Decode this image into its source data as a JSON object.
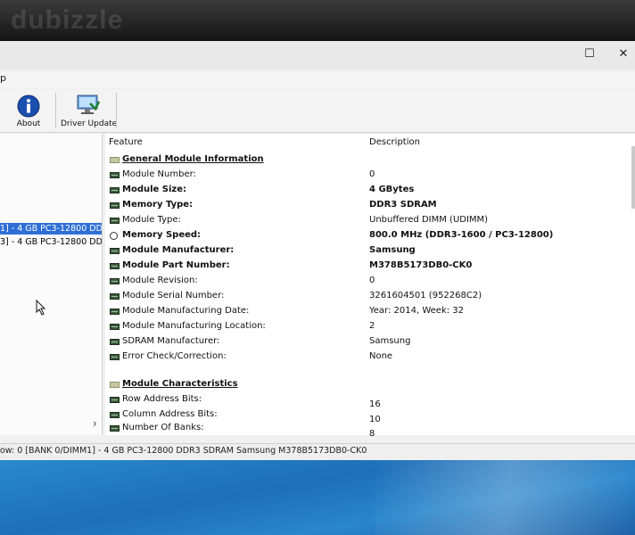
{
  "watermark": "dubizzle",
  "window": {
    "menu": "p",
    "controls": {
      "maximize": "☐",
      "close": "✕"
    }
  },
  "toolbar": {
    "about_label": "About",
    "driver_update_label": "Driver Update"
  },
  "tree": {
    "items": [
      {
        "label": "1] - 4 GB PC3-12800 DD",
        "selected": true
      },
      {
        "label": "3] - 4 GB PC3-12800 DD",
        "selected": false
      }
    ],
    "expand_glyph": "›"
  },
  "detail": {
    "headers": {
      "feature": "Feature",
      "description": "Description"
    },
    "sections": [
      {
        "title": "General Module Information",
        "rows": [
          {
            "feature": "Module Number:",
            "value": "0",
            "bold": false,
            "icon": "chip-icon"
          },
          {
            "feature": "Module Size:",
            "value": "4 GBytes",
            "bold": true,
            "icon": "chip-icon"
          },
          {
            "feature": "Memory Type:",
            "value": "DDR3 SDRAM",
            "bold": true,
            "icon": "chip-icon"
          },
          {
            "feature": "Module Type:",
            "value": "Unbuffered DIMM (UDIMM)",
            "bold": false,
            "icon": "chip-icon"
          },
          {
            "feature": "Memory Speed:",
            "value": "800.0 MHz (DDR3-1600 / PC3-12800)",
            "bold": true,
            "icon": "clock-icon"
          },
          {
            "feature": "Module Manufacturer:",
            "value": "Samsung",
            "bold": true,
            "icon": "chip-icon"
          },
          {
            "feature": "Module Part Number:",
            "value": "M378B5173DB0-CK0",
            "bold": true,
            "icon": "chip-icon"
          },
          {
            "feature": "Module Revision:",
            "value": "0",
            "bold": false,
            "icon": "chip-icon"
          },
          {
            "feature": "Module Serial Number:",
            "value": "3261604501 (952268C2)",
            "bold": false,
            "icon": "chip-icon"
          },
          {
            "feature": "Module Manufacturing Date:",
            "value": "Year: 2014, Week: 32",
            "bold": false,
            "icon": "chip-icon"
          },
          {
            "feature": "Module Manufacturing Location:",
            "value": "2",
            "bold": false,
            "icon": "chip-icon"
          },
          {
            "feature": "SDRAM Manufacturer:",
            "value": "Samsung",
            "bold": false,
            "icon": "chip-icon"
          },
          {
            "feature": "Error Check/Correction:",
            "value": "None",
            "bold": false,
            "icon": "chip-icon"
          }
        ]
      },
      {
        "title": "Module Characteristics",
        "rows": [
          {
            "feature": "Row Address Bits:",
            "value": "16",
            "bold": false,
            "icon": "chip-icon"
          },
          {
            "feature": "Column Address Bits:",
            "value": "10",
            "bold": false,
            "icon": "chip-icon"
          },
          {
            "feature": "Number Of Banks:",
            "value": "8",
            "bold": false,
            "icon": "chip-icon"
          }
        ]
      }
    ]
  },
  "status": "ow: 0 [BANK 0/DIMM1] - 4 GB PC3-12800 DDR3 SDRAM Samsung M378B5173DB0-CK0"
}
